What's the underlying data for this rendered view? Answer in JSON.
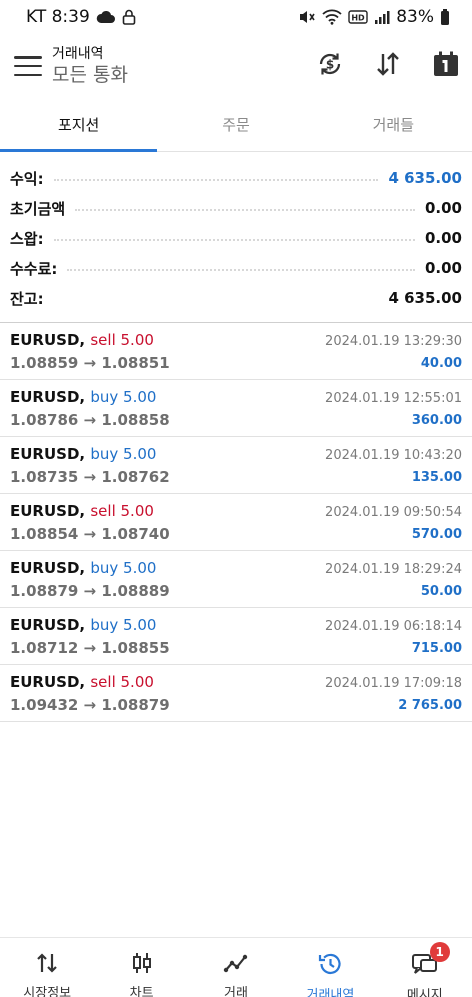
{
  "status_bar": {
    "carrier_time": "KT 8:39",
    "battery": "83%",
    "icons": [
      "cloud-icon",
      "lock-icon",
      "mute-icon",
      "wifi-icon",
      "hd-icon",
      "signal-icon",
      "battery-icon"
    ]
  },
  "header": {
    "title": "거래내역",
    "subtitle": "모든 통화",
    "icons": [
      "currency-exchange-icon",
      "sort-icon",
      "calendar-icon"
    ]
  },
  "tabs": [
    {
      "label": "포지션",
      "active": true
    },
    {
      "label": "주문",
      "active": false
    },
    {
      "label": "거래들",
      "active": false
    }
  ],
  "summary": [
    {
      "label": "수익:",
      "value": "4 635.00",
      "color": "#1f6fc7"
    },
    {
      "label": "초기금액",
      "value": "0.00"
    },
    {
      "label": "스왑:",
      "value": "0.00"
    },
    {
      "label": "수수료:",
      "value": "0.00"
    },
    {
      "label": "잔고:",
      "value": "4 635.00"
    }
  ],
  "deals": [
    {
      "symbol": "EURUSD,",
      "side": "sell 5.00",
      "type": "sell",
      "prices": "1.08859 → 1.08851",
      "time": "2024.01.19 13:29:30",
      "profit": "40.00"
    },
    {
      "symbol": "EURUSD,",
      "side": "buy 5.00",
      "type": "buy",
      "prices": "1.08786 → 1.08858",
      "time": "2024.01.19 12:55:01",
      "profit": "360.00"
    },
    {
      "symbol": "EURUSD,",
      "side": "buy 5.00",
      "type": "buy",
      "prices": "1.08735 → 1.08762",
      "time": "2024.01.19 10:43:20",
      "profit": "135.00"
    },
    {
      "symbol": "EURUSD,",
      "side": "sell 5.00",
      "type": "sell",
      "prices": "1.08854 → 1.08740",
      "time": "2024.01.19 09:50:54",
      "profit": "570.00"
    },
    {
      "symbol": "EURUSD,",
      "side": "buy 5.00",
      "type": "buy",
      "prices": "1.08879 → 1.08889",
      "time": "2024.01.19 18:29:24",
      "profit": "50.00"
    },
    {
      "symbol": "EURUSD,",
      "side": "buy 5.00",
      "type": "buy",
      "prices": "1.08712 → 1.08855",
      "time": "2024.01.19 06:18:14",
      "profit": "715.00"
    },
    {
      "symbol": "EURUSD,",
      "side": "sell 5.00",
      "type": "sell",
      "prices": "1.09432 → 1.08879",
      "time": "2024.01.19 17:09:18",
      "profit": "2 765.00"
    }
  ],
  "bottom_nav": [
    {
      "label": "시장정보",
      "icon": "sort-arrows-icon",
      "active": false
    },
    {
      "label": "차트",
      "icon": "candlestick-icon",
      "active": false
    },
    {
      "label": "거래",
      "icon": "trend-line-icon",
      "active": false
    },
    {
      "label": "거래내역",
      "icon": "history-icon",
      "active": true
    },
    {
      "label": "메시지",
      "icon": "chat-icon",
      "active": false,
      "badge": "1"
    }
  ],
  "colors": {
    "accent": "#2a78d6",
    "buy": "#1f6fc7",
    "sell": "#c8102e",
    "profit": "#1f6fc7"
  }
}
